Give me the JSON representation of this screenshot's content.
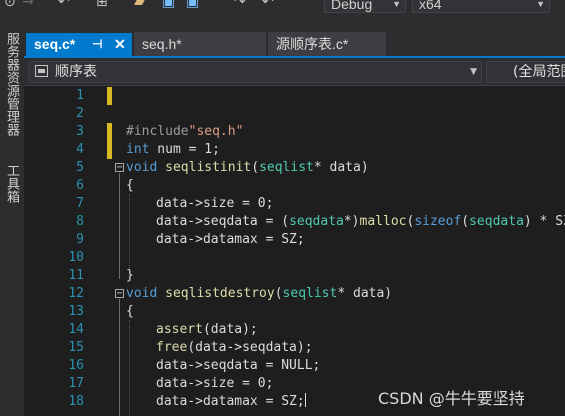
{
  "toolbar": {
    "config_combo": "Debug",
    "platform_combo": "x64"
  },
  "side_panels": [
    "服务器资源管理器",
    "工具箱"
  ],
  "tabs": [
    {
      "label": "seq.c*",
      "pin": "⊣",
      "close": "✕"
    },
    {
      "label": "seq.h*"
    },
    {
      "label": "源顺序表.c*"
    }
  ],
  "navigation": {
    "project": "顺序表",
    "scope": "(全局范围)"
  },
  "code": {
    "line_numbers": [
      "1",
      "2",
      "3",
      "4",
      "5",
      "6",
      "7",
      "8",
      "9",
      "10",
      "11",
      "12",
      "13",
      "14",
      "15",
      "16",
      "17",
      "18"
    ],
    "line_3_pp": "#include",
    "line_3_str": "\"seq.h\"",
    "line_4_kw": "int",
    "line_4_rest": " num = 1;",
    "line_5_kw": "void",
    "line_5_fn": "seqlistinit",
    "line_5_open": "(",
    "line_5_ty": "seqlist",
    "line_5_rest": "* data)",
    "line_6": "{",
    "line_7": "data->size = 0;",
    "line_8_a": "data->seqdata = (",
    "line_8_ty": "seqdata",
    "line_8_b": "*)",
    "line_8_fn": "malloc",
    "line_8_c": "(",
    "line_8_kw": "sizeof",
    "line_8_d": "(",
    "line_8_ty2": "seqdata",
    "line_8_e": ") * SZ);",
    "line_9": "data->datamax = SZ;",
    "line_11": "}",
    "line_12_kw": "void",
    "line_12_fn": "seqlistdestroy",
    "line_12_open": "(",
    "line_12_ty": "seqlist",
    "line_12_rest": "* data)",
    "line_13": "{",
    "line_14_fn": "assert",
    "line_14_rest": "(data);",
    "line_15_fn": "free",
    "line_15_rest": "(data->seqdata);",
    "line_16": "data->seqdata = NULL;",
    "line_17": "data->size = 0;",
    "line_18": "data->datamax = SZ;"
  },
  "watermark": "CSDN @牛牛要坚持",
  "colors": {
    "accent": "#007acc",
    "change_marker": "#d7ba22",
    "line_number": "#2b91af",
    "keyword": "#569cd6",
    "type": "#4ec9b0",
    "function": "#dcdcaa",
    "string": "#d69d85"
  }
}
